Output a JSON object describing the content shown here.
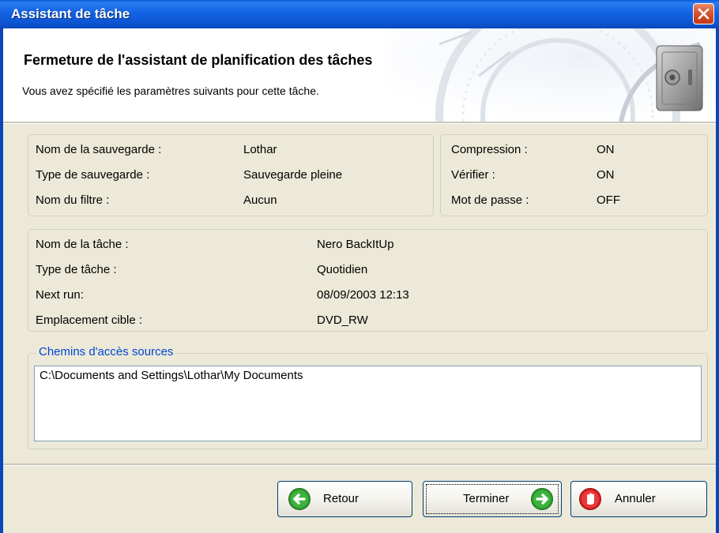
{
  "window": {
    "title": "Assistant de tâche"
  },
  "header": {
    "title": "Fermeture de l'assistant de planification des tâches",
    "subtitle": "Vous avez spécifié les paramètres suivants pour cette tâche."
  },
  "backup": {
    "name_label": "Nom de la sauvegarde :",
    "name_value": "Lothar",
    "type_label": "Type de sauvegarde :",
    "type_value": "Sauvegarde pleine",
    "filter_label": "Nom du filtre :",
    "filter_value": "Aucun"
  },
  "options": {
    "compression_label": "Compression :",
    "compression_value": "ON",
    "verify_label": "Vérifier :",
    "verify_value": "ON",
    "password_label": "Mot de passe :",
    "password_value": "OFF"
  },
  "task": {
    "name_label": "Nom de la tâche :",
    "name_value": "Nero BackItUp",
    "type_label": "Type de tâche :",
    "type_value": "Quotidien",
    "next_run_label": "Next run:",
    "next_run_value": "08/09/2003 12:13",
    "target_label": "Emplacement cible :",
    "target_value": "DVD_RW"
  },
  "sources": {
    "legend": "Chemins d'accès sources",
    "paths": [
      "C:\\Documents and Settings\\Lothar\\My Documents"
    ]
  },
  "buttons": {
    "back": "Retour",
    "finish": "Terminer",
    "cancel": "Annuler"
  },
  "colors": {
    "titlebar": "#0c55d3",
    "panel": "#ece9d8",
    "legend": "#0046d5",
    "close": "#d6542f",
    "arrow_green": "#2e9a2e",
    "stop_red": "#d61f1f"
  },
  "icons": {
    "close": "close-icon",
    "back": "arrow-left-icon",
    "finish": "arrow-right-icon",
    "cancel": "stop-hand-icon",
    "header": "safe-icon"
  }
}
